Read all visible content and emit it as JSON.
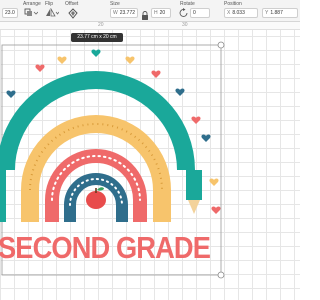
{
  "toolbar": {
    "size_input_prefix": "23.0",
    "arrange_label": "Arrange",
    "flip_label": "Flip",
    "offset_label": "Offset",
    "size_label": "Size",
    "width_prefix": "W",
    "width_value": "23.772",
    "height_prefix": "H",
    "height_value": "20",
    "rotate_label": "Rotate",
    "rotate_value": "0",
    "position_label": "Position",
    "x_prefix": "X",
    "x_value": "8.033",
    "y_prefix": "Y",
    "y_value": "1.887"
  },
  "ruler": {
    "mark_1": "20",
    "mark_2": "30"
  },
  "canvas": {
    "size_tooltip": "23.77 cm x 20 cm",
    "design_text": "SECOND GRADE"
  },
  "colors": {
    "teal": "#1aa89a",
    "orange": "#f7c46c",
    "coral": "#ef6a6a",
    "navy": "#2f6e8c",
    "apple": "#e84c4c"
  }
}
